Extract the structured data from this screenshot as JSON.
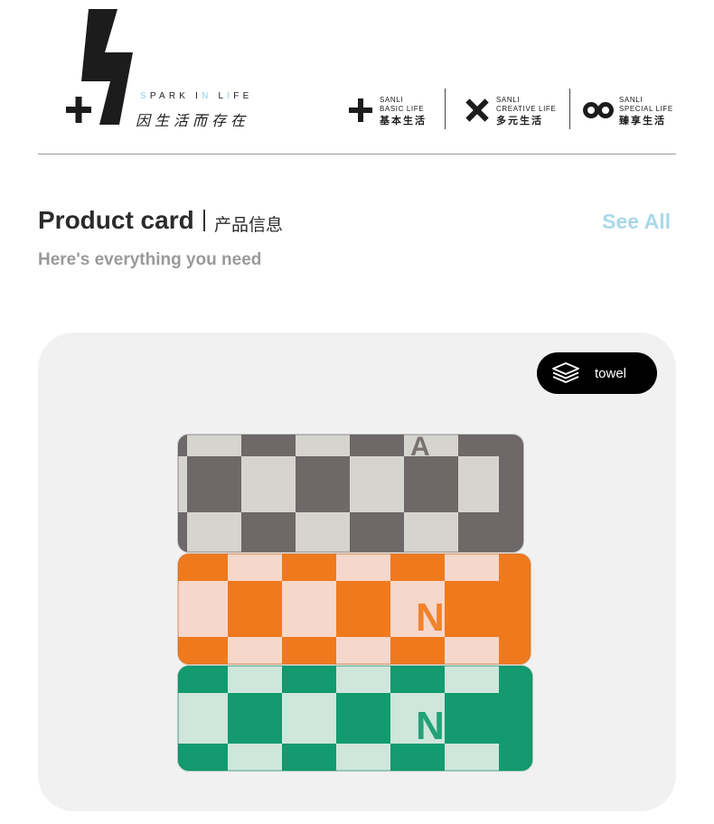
{
  "header": {
    "slogan_en_parts": [
      "S",
      "PARK I",
      "N",
      " L",
      "I",
      "FE"
    ],
    "slogan_cn": "因生活而存在",
    "series": [
      {
        "icon": "plus-icon",
        "brand": "SANLI",
        "life": "BASIC LIFE",
        "cn": "基本生活"
      },
      {
        "icon": "cross-icon",
        "brand": "SANLI",
        "life": "CREATIVE LIFE",
        "cn": "多元生活"
      },
      {
        "icon": "infinity-icon",
        "brand": "SANLI",
        "life": "SPECIAL LIFE",
        "cn": "臻享生活"
      }
    ]
  },
  "section": {
    "title": "Product card",
    "title_cn": "产品信息",
    "subtitle": "Here's everything you need",
    "see_all": "See All"
  },
  "card": {
    "tag_icon": "layers-icon",
    "tag_label": "towel",
    "product_image": "stack of three checkered towels",
    "towels": [
      {
        "color": "grey",
        "dark": "#6e6869",
        "light": "#d6d4ce"
      },
      {
        "color": "orange",
        "dark": "#ef7a1e",
        "light": "#f6d7cb"
      },
      {
        "color": "green",
        "dark": "#139a6e",
        "light": "#cfe6dc"
      }
    ]
  },
  "colors": {
    "accent": "#a9d8ea",
    "text_dark": "#2b2b2b",
    "text_muted": "#9a9a9a",
    "card_bg": "#f1f1f1"
  }
}
